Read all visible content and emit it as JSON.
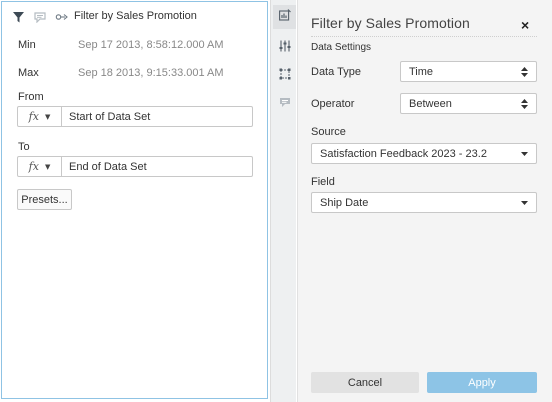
{
  "filter_widget": {
    "title": "Filter by Sales Promotion",
    "min_label": "Min",
    "min_value": "Sep 17 2013, 8:58:12.000 AM",
    "max_label": "Max",
    "max_value": "Sep 18 2013, 9:15:33.001 AM",
    "from_label": "From",
    "from_fx": "fx",
    "from_value": "Start of Data Set",
    "to_label": "To",
    "to_fx": "fx",
    "to_value": "End of Data Set",
    "presets_label": "Presets...",
    "icons": [
      "funnel-icon",
      "comment-icon",
      "link-icon"
    ]
  },
  "rail": {
    "icons": [
      "data-settings-icon",
      "sliders-icon",
      "frame-icon",
      "comment-icon"
    ]
  },
  "panel": {
    "title": "Filter by Sales Promotion",
    "close_label": "×",
    "section": "Data Settings",
    "data_type_label": "Data Type",
    "data_type_value": "Time",
    "operator_label": "Operator",
    "operator_value": "Between",
    "source_label": "Source",
    "source_value": "Satisfaction Feedback 2023 - 23.2",
    "field_label": "Field",
    "field_value": "Ship Date",
    "cancel_label": "Cancel",
    "apply_label": "Apply"
  },
  "colors": {
    "accent": "#8dc4e6",
    "widget_border": "#8fc3e4",
    "panel_bg": "#f4f4f4"
  }
}
